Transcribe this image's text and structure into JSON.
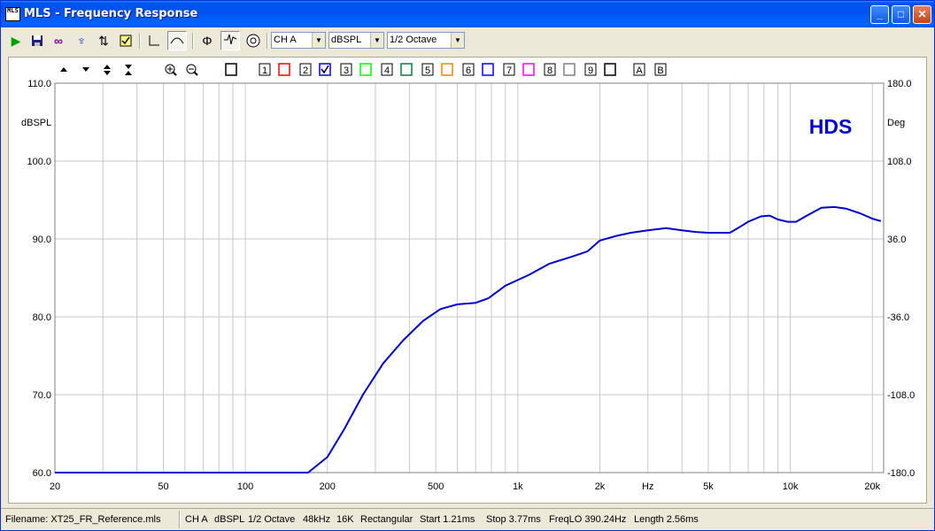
{
  "window": {
    "title": "MLS - Frequency Response",
    "app_icon_text": "MLS",
    "controls": [
      "_",
      "□",
      "✕"
    ]
  },
  "toolbar": {
    "icons": [
      "play-icon",
      "save-icon",
      "loop-icon",
      "probe-icon",
      "marker-icon",
      "checklist-icon",
      "lin-axis-icon",
      "smooth-icon",
      "phase-icon",
      "impulse-icon",
      "target-icon"
    ],
    "channel": "CH A",
    "units": "dBSPL",
    "smoothing": "1/2 Octave"
  },
  "plot": {
    "icon_row_labels": [
      "1",
      "2",
      "3",
      "4",
      "5",
      "6",
      "7",
      "8",
      "9",
      "A",
      "B"
    ],
    "trace_colors": [
      "#ff0000",
      "#0000ff",
      "#00ff00",
      "#008040",
      "#ff8000",
      "#0000ff",
      "#ff00ff",
      "#808080",
      "#000000"
    ],
    "trace2_checked": true,
    "watermark": "HDS",
    "left_unit": "dBSPL",
    "right_unit": "Deg",
    "trace_color": "#0000d0"
  },
  "chart_data": {
    "type": "line",
    "x_scale": "log",
    "xlim": [
      20,
      22000
    ],
    "ylim": [
      60,
      110
    ],
    "y2lim": [
      -180,
      180
    ],
    "ylabel": "dBSPL",
    "y2label": "Deg",
    "y_ticks": [
      60,
      70,
      80,
      90,
      100,
      110
    ],
    "y_tick_labels": [
      "60.0",
      "70.0",
      "80.0",
      "90.0",
      "100.0",
      "110.0"
    ],
    "y2_tick_labels": [
      "-180.0",
      "-108.0",
      "-36.0",
      "36.0",
      "108.0",
      "180.0"
    ],
    "x_tick_values": [
      20,
      50,
      100,
      200,
      500,
      1000,
      2000,
      5000,
      10000,
      20000
    ],
    "x_tick_labels": [
      "20",
      "50",
      "100",
      "200",
      "500",
      "1k",
      "2k",
      "5k",
      "10k",
      "20k"
    ],
    "x_unit_label": "Hz",
    "x_unit_position": 3000,
    "grid": true,
    "series": [
      {
        "x": [
          20,
          100,
          170,
          200,
          230,
          270,
          320,
          380,
          450,
          520,
          600,
          700,
          780,
          900,
          1100,
          1300,
          1600,
          1800,
          2000,
          2300,
          2600,
          3000,
          3500,
          4000,
          4500,
          5000,
          6000,
          6500,
          7000,
          7800,
          8400,
          9000,
          9800,
          10500,
          11500,
          13000,
          14500,
          16000,
          18000,
          20000,
          21500
        ],
        "y": [
          60,
          60,
          60,
          62,
          65.5,
          70,
          74,
          77,
          79.5,
          81,
          81.6,
          81.8,
          82.4,
          84,
          85.4,
          86.8,
          87.8,
          88.4,
          89.8,
          90.4,
          90.8,
          91.1,
          91.4,
          91.1,
          90.9,
          90.8,
          90.8,
          91.5,
          92.2,
          92.9,
          93,
          92.5,
          92.2,
          92.2,
          93,
          94,
          94.1,
          93.9,
          93.3,
          92.6,
          92.3
        ]
      }
    ]
  },
  "status": {
    "filename": "Filename: XT25_FR_Reference.mls",
    "fields": [
      "CH A",
      "dBSPL",
      "1/2 Octave",
      "48kHz",
      "16K",
      "Rectangular",
      "Start 1.21ms",
      "Stop 3.77ms",
      "FreqLO 390.24Hz",
      "Length 2.56ms"
    ]
  }
}
